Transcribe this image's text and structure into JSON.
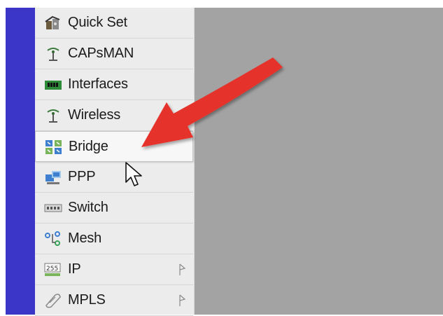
{
  "menu": {
    "items": [
      {
        "label": "Quick Set",
        "icon": "quick-set-icon"
      },
      {
        "label": "CAPsMAN",
        "icon": "capsman-antenna-icon"
      },
      {
        "label": "Interfaces",
        "icon": "interfaces-icon"
      },
      {
        "label": "Wireless",
        "icon": "wireless-antenna-icon"
      },
      {
        "label": "Bridge",
        "icon": "bridge-icon"
      },
      {
        "label": "PPP",
        "icon": "ppp-icon"
      },
      {
        "label": "Switch",
        "icon": "switch-icon"
      },
      {
        "label": "Mesh",
        "icon": "mesh-icon"
      },
      {
        "label": "IP",
        "icon": "ip-icon",
        "submenu": true
      },
      {
        "label": "MPLS",
        "icon": "mpls-icon",
        "submenu": true
      }
    ],
    "hovered": "Bridge"
  },
  "colors": {
    "stripe": "#3b36c8",
    "workspace": "#a3a3a3",
    "menu_bg": "#ececec",
    "annotation_arrow": "#e5332a"
  },
  "annotation": {
    "type": "red-arrow",
    "points_to": "Bridge"
  }
}
